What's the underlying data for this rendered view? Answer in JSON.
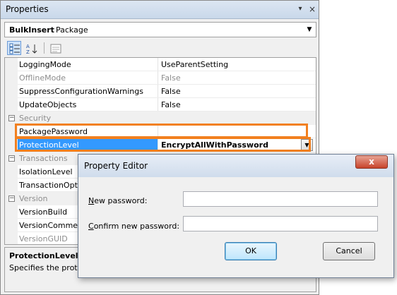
{
  "window": {
    "title": "Properties",
    "pin_glyph": "▾",
    "close_glyph": "×"
  },
  "object_selector": {
    "name": "BulkInsert",
    "type": "Package"
  },
  "rows": {
    "logging": {
      "name": "LoggingMode",
      "value": "UseParentSetting"
    },
    "offline": {
      "name": "OfflineMode",
      "value": "False"
    },
    "suppress": {
      "name": "SuppressConfigurationWarnings",
      "value": "False"
    },
    "update": {
      "name": "UpdateObjects",
      "value": "False"
    },
    "security": {
      "label": "Security"
    },
    "password": {
      "name": "PackagePassword",
      "value": ""
    },
    "protection": {
      "name": "ProtectionLevel",
      "value": "EncryptAllWithPassword"
    },
    "transactions": {
      "label": "Transactions"
    },
    "isolation": {
      "name": "IsolationLevel"
    },
    "transopt": {
      "name": "TransactionOpt"
    },
    "version": {
      "label": "Version"
    },
    "vbuild": {
      "name": "VersionBuild"
    },
    "vcomment": {
      "name": "VersionComme"
    },
    "vguid": {
      "name": "VersionGUID"
    }
  },
  "description": {
    "heading": "ProtectionLevel",
    "text": "Specifies the prote"
  },
  "dialog": {
    "title": "Property Editor",
    "close_glyph": "x",
    "new_password_label": "New password:",
    "confirm_password_label": "Confirm new password:",
    "new_password_value": "",
    "confirm_password_value": "",
    "ok_label": "OK",
    "cancel_label": "Cancel"
  },
  "colors": {
    "highlight": "#f2801f",
    "selection": "#3399ff"
  }
}
